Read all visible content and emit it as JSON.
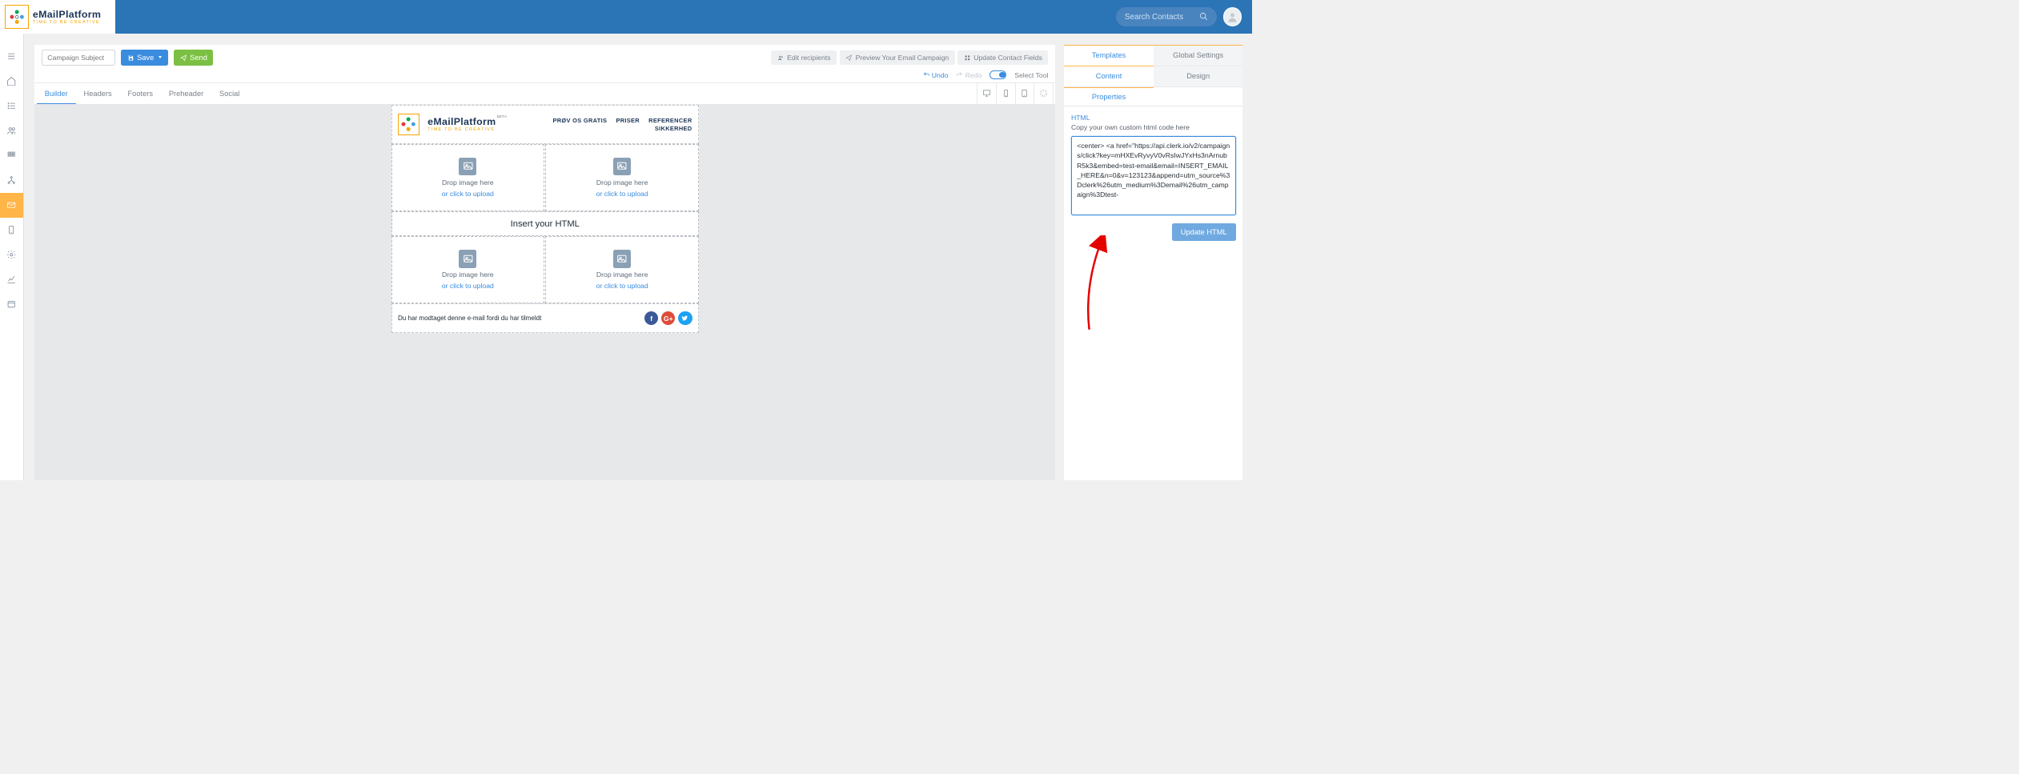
{
  "brand": {
    "name": "eMailPlatform",
    "tagline": "TIME TO BE CREATIVE"
  },
  "search": {
    "placeholder": "Search Contacts"
  },
  "toolbar": {
    "subject_placeholder": "Campaign Subject",
    "save_label": "Save",
    "send_label": "Send",
    "edit_recipients": "Edit recipients",
    "preview": "Preview Your Email Campaign",
    "update_fields": "Update Contact Fields",
    "undo": "Undo",
    "redo": "Redo",
    "select_tool": "Select Tool"
  },
  "tabs": {
    "builder": "Builder",
    "headers": "Headers",
    "footers": "Footers",
    "preheader": "Preheader",
    "social": "Social"
  },
  "email": {
    "beta": "BETA",
    "nav": {
      "a": "PRØV OS GRATIS",
      "b": "PRISER",
      "c": "REFERENCER",
      "d": "SIKKERHED"
    },
    "drop1": "Drop image here",
    "drop2": "or click to upload",
    "html_row": "Insert your HTML",
    "footer_text": "Du har modtaget denne e-mail fordi du har tilmeldt"
  },
  "right": {
    "tab_templates": "Templates",
    "tab_global": "Global Settings",
    "tab_content": "Content",
    "tab_design": "Design",
    "tab_properties": "Properties",
    "html_label": "HTML",
    "html_hint": "Copy your own custom html code here",
    "html_code": "<center> <a href=\"https://api.clerk.io/v2/campaigns/click?key=mHXEvRyvyV0vRsIwJYxHs3nArnubR5k3&embed=test-email&email=INSERT_EMAIL_HERE&n=0&v=123123&append=utm_source%3Dclerk%26utm_medium%3Demail%26utm_campaign%3Dtest-",
    "update_label": "Update HTML"
  }
}
